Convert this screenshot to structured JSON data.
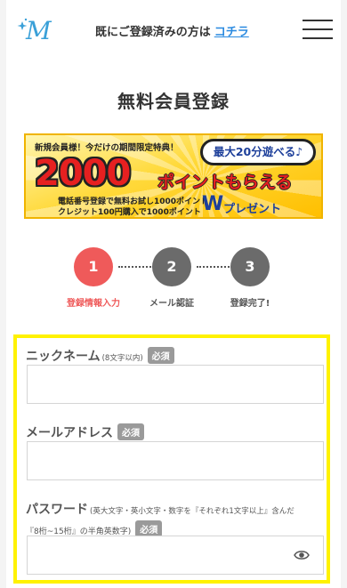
{
  "header": {
    "logo_letter": "M",
    "prompt_text": "既にご登録済みの方は",
    "login_link": "コチラ"
  },
  "page_title": "無料会員登録",
  "banner": {
    "top_text": "新規会員様！今だけの期間限定特典！",
    "bubble_text": "最大20分遊べる♪",
    "amount": "2000",
    "amount_suffix": "ポイントもらえる",
    "line1": "電話番号登録で無料お試し1000ポイント",
    "line2": "クレジット100円購入で1000ポイント",
    "w_letter": "W",
    "present_text": "プレゼント"
  },
  "steps": [
    {
      "number": "1",
      "label": "登録情報入力",
      "active": true,
      "color": "#ef5a5a"
    },
    {
      "number": "2",
      "label": "メール認証",
      "active": false,
      "color": "#6b6b6b"
    },
    {
      "number": "3",
      "label": "登録完了!",
      "active": false,
      "color": "#6b6b6b"
    }
  ],
  "form": {
    "nickname": {
      "label": "ニックネーム",
      "note": "(8文字以内)",
      "required": "必須",
      "value": ""
    },
    "email": {
      "label": "メールアドレス",
      "required": "必須",
      "value": ""
    },
    "password": {
      "label": "パスワード",
      "note_line1": "(英大文字・英小文字・数字を『それぞれ1文字以上』含んだ",
      "note_line2": "『8桁~15桁』の半角英数字)",
      "required": "必須",
      "value": "",
      "toggle_icon": "eye-icon"
    }
  },
  "colors": {
    "accent_red": "#ef5a5a",
    "step_gray": "#6b6b6b",
    "link_blue": "#2a8ae0",
    "form_border": "#fff200",
    "logo_blue": "#3aa0d8"
  }
}
